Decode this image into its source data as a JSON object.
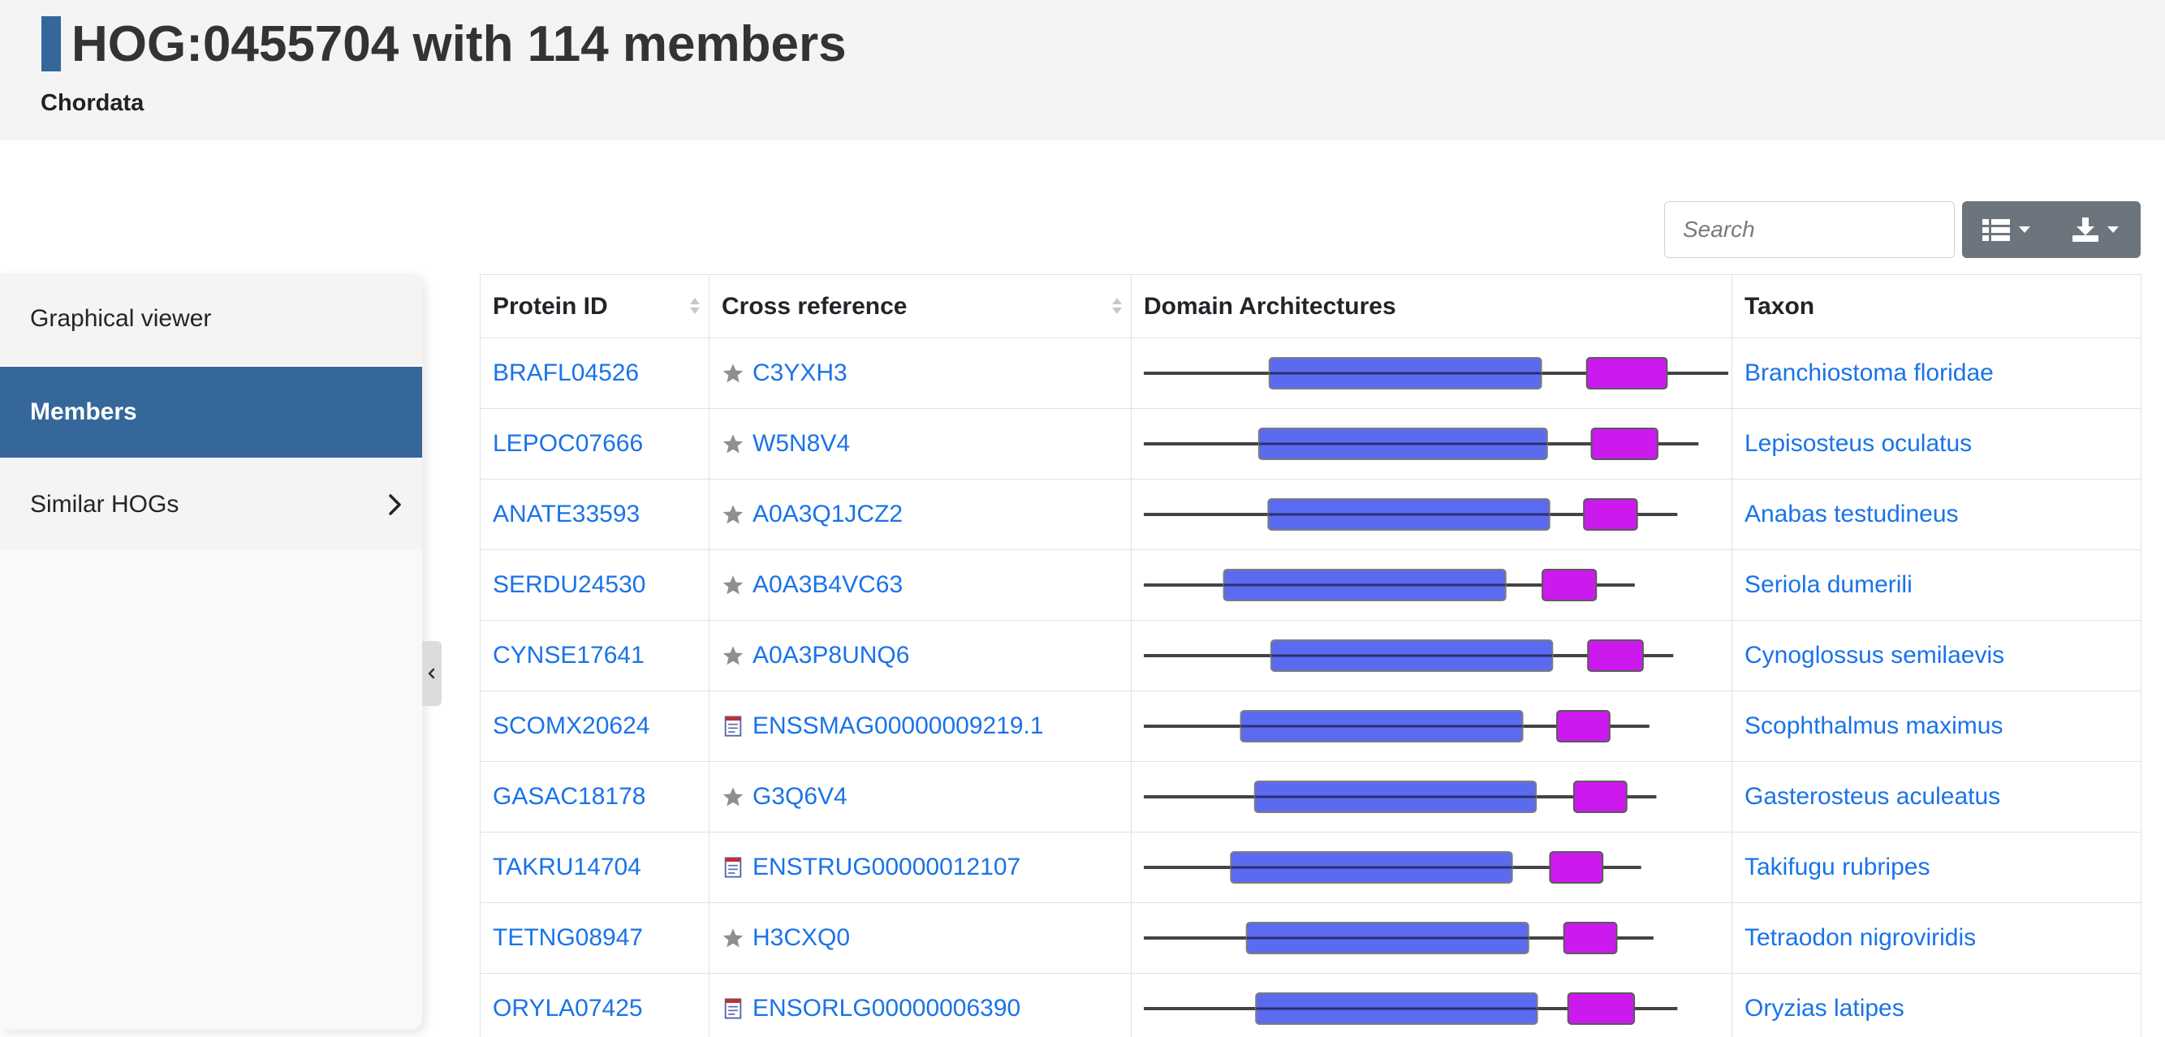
{
  "header": {
    "title": "HOG:0455704 with 114 members",
    "subtitle": "Chordata"
  },
  "sidebar": {
    "items": [
      {
        "label": "Graphical viewer"
      },
      {
        "label": "Members"
      },
      {
        "label": "Similar HOGs"
      }
    ]
  },
  "toolbar": {
    "search_placeholder": "Search",
    "columns_icon": "list-icon",
    "download_icon": "download-icon"
  },
  "table": {
    "columns": [
      "Protein ID",
      "Cross reference",
      "Domain Architectures",
      "Taxon"
    ],
    "rows": [
      {
        "protein_id": "BRAFL04526",
        "xref": "C3YXH3",
        "xref_icon": "star-icon",
        "taxon": "Branchiostoma floridae",
        "domains": {
          "length": 1.0,
          "blue": [
            0.215,
            0.68
          ],
          "magenta": [
            0.758,
            0.895
          ]
        }
      },
      {
        "protein_id": "LEPOC07666",
        "xref": "W5N8V4",
        "xref_icon": "star-icon",
        "taxon": "Lepisosteus oculatus",
        "domains": {
          "length": 0.949,
          "blue": [
            0.197,
            0.69
          ],
          "magenta": [
            0.766,
            0.879
          ]
        }
      },
      {
        "protein_id": "ANATE33593",
        "xref": "A0A3Q1JCZ2",
        "xref_icon": "star-icon",
        "taxon": "Anabas testudineus",
        "domains": {
          "length": 0.913,
          "blue": [
            0.213,
            0.694
          ],
          "magenta": [
            0.753,
            0.844
          ]
        }
      },
      {
        "protein_id": "SERDU24530",
        "xref": "A0A3B4VC63",
        "xref_icon": "star-icon",
        "taxon": "Seriola dumerili",
        "domains": {
          "length": 0.84,
          "blue": [
            0.137,
            0.619
          ],
          "magenta": [
            0.682,
            0.774
          ]
        }
      },
      {
        "protein_id": "CYNSE17641",
        "xref": "A0A3P8UNQ6",
        "xref_icon": "star-icon",
        "taxon": "Cynoglossus semilaevis",
        "domains": {
          "length": 0.906,
          "blue": [
            0.218,
            0.699
          ],
          "magenta": [
            0.76,
            0.854
          ]
        }
      },
      {
        "protein_id": "SCOMX20624",
        "xref": "ENSSMAG00000009219.1",
        "xref_icon": "document-icon",
        "taxon": "Scophthalmus maximus",
        "domains": {
          "length": 0.865,
          "blue": [
            0.166,
            0.648
          ],
          "magenta": [
            0.707,
            0.797
          ]
        }
      },
      {
        "protein_id": "GASAC18178",
        "xref": "G3Q6V4",
        "xref_icon": "star-icon",
        "taxon": "Gasterosteus aculeatus",
        "domains": {
          "length": 0.877,
          "blue": [
            0.19,
            0.671
          ],
          "magenta": [
            0.736,
            0.826
          ]
        }
      },
      {
        "protein_id": "TAKRU14704",
        "xref": "ENSTRUG00000012107",
        "xref_icon": "document-icon",
        "taxon": "Takifugu rubripes",
        "domains": {
          "length": 0.851,
          "blue": [
            0.149,
            0.63
          ],
          "magenta": [
            0.695,
            0.785
          ]
        }
      },
      {
        "protein_id": "TETNG08947",
        "xref": "H3CXQ0",
        "xref_icon": "star-icon",
        "taxon": "Tetraodon nigroviridis",
        "domains": {
          "length": 0.872,
          "blue": [
            0.176,
            0.658
          ],
          "magenta": [
            0.719,
            0.809
          ]
        }
      },
      {
        "protein_id": "ORYLA07425",
        "xref": "ENSORLG00000006390",
        "xref_icon": "document-icon",
        "taxon": "Oryzias latipes",
        "domains": {
          "length": 0.913,
          "blue": [
            0.192,
            0.673
          ],
          "magenta": [
            0.726,
            0.839
          ]
        }
      }
    ]
  },
  "colors": {
    "accent": "#35679a",
    "link": "#1a73e8",
    "domain_blue": "#5b6bef",
    "domain_magenta": "#cc1aee",
    "backbone": "#444444",
    "button_gray": "#6c757d"
  }
}
